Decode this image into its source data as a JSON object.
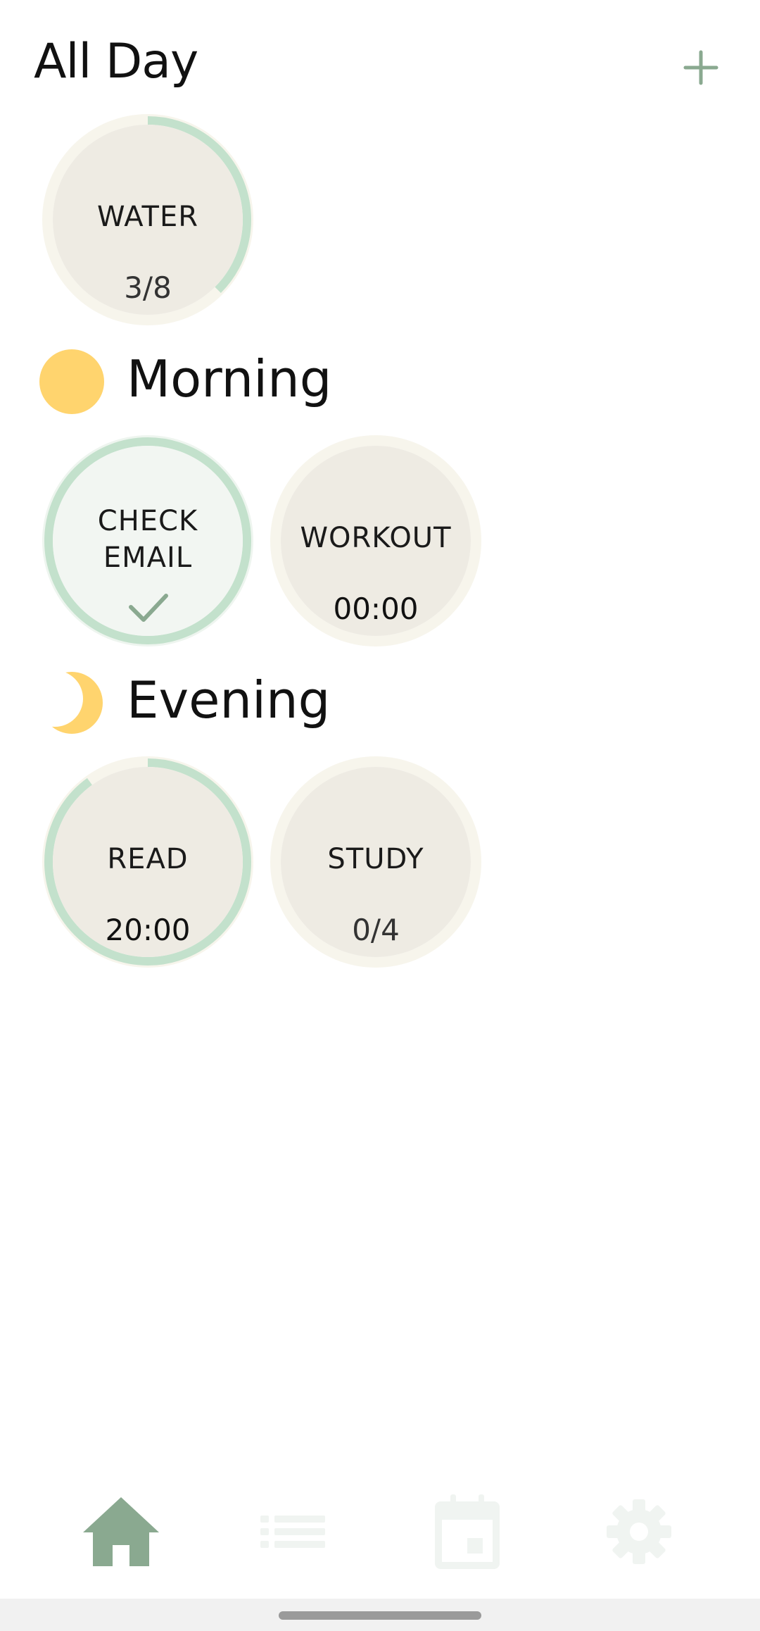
{
  "header": {
    "title": "All Day",
    "add_icon": "plus-icon"
  },
  "colors": {
    "accent": "#8aa990",
    "ring_progress": "#c3e1cc",
    "ring_track": "#f7f5ec",
    "tile_fill": "#eeebe3",
    "tile_done_fill": "#f2f6f2",
    "sun": "#ffd46e"
  },
  "sections": {
    "all_day": {
      "habits": [
        {
          "name": "WATER",
          "value": "3/8",
          "progress": 0.375
        }
      ]
    },
    "morning": {
      "title": "Morning",
      "icon": "sun-icon",
      "habits": [
        {
          "name_line1": "CHECK",
          "name_line2": "EMAIL",
          "done": true,
          "icon": "check-icon"
        },
        {
          "name": "WORKOUT",
          "value": "00:00",
          "progress": 0
        }
      ]
    },
    "evening": {
      "title": "Evening",
      "icon": "moon-icon",
      "habits": [
        {
          "name": "READ",
          "value": "20:00",
          "progress": 0.9
        },
        {
          "name": "STUDY",
          "value": "0/4",
          "progress": 0
        }
      ]
    }
  },
  "bottom_nav": {
    "items": [
      {
        "icon": "home-icon",
        "active": true
      },
      {
        "icon": "list-icon",
        "active": false
      },
      {
        "icon": "calendar-icon",
        "active": false
      },
      {
        "icon": "gear-icon",
        "active": false
      }
    ]
  }
}
